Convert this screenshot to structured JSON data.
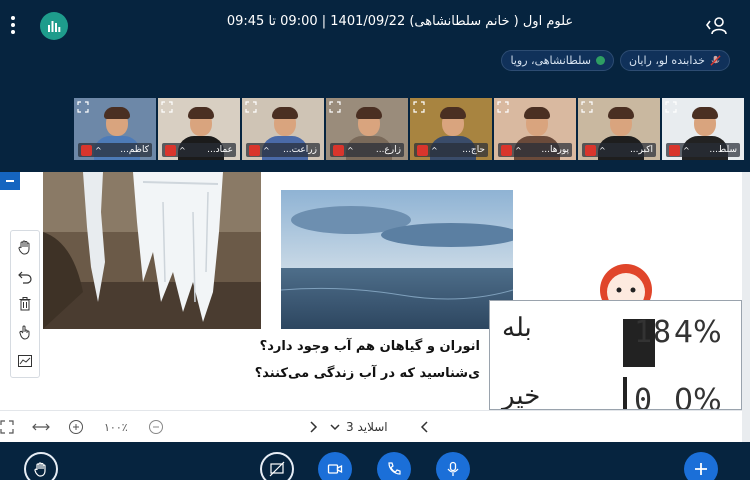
{
  "header": {
    "title": "علوم اول ( خانم سلطانشاهی) 1401/09/22 | 09:00 تا 09:45"
  },
  "presenters": [
    {
      "name": "سلطانشاهی، رویا",
      "status": "talking"
    },
    {
      "name": "خدابنده لو، رایان",
      "status": "muted"
    }
  ],
  "webcams": [
    {
      "label": "کاظم...",
      "bg": "#6d88a8",
      "body": "#4d7bb8"
    },
    {
      "label": "عماد...",
      "bg": "#d8cfc2",
      "body": "#1b1b1b"
    },
    {
      "label": "زراعت...",
      "bg": "#cfc4b5",
      "body": "#4a6aa8"
    },
    {
      "label": "زارع...",
      "bg": "#9a8c7b",
      "body": "#7a6a5a"
    },
    {
      "label": "حاج...",
      "bg": "#a88440",
      "body": "#3a4c6a"
    },
    {
      "label": "پورها...",
      "bg": "#d9b9a0",
      "body": "#6a4a3a"
    },
    {
      "label": "اکبر...",
      "bg": "#c9b8a0",
      "body": "#1e1e1e"
    },
    {
      "label": "سلط...",
      "bg": "#e8ecef",
      "body": "#222222"
    }
  ],
  "whiteboard": {
    "question_line1": "انوران و گیاهان هم آب وجود دارد؟",
    "question_line2": "ی‌شناسید که در آب زندگی می‌کنند؟"
  },
  "poll": {
    "rows": [
      {
        "answer": "بله",
        "count": "18",
        "percent": "4%"
      },
      {
        "answer": "خیر",
        "count": "0",
        "percent": "0%"
      }
    ]
  },
  "slide_controls": {
    "zoom": "۱۰۰٪",
    "slide_label": "اسلاید 3"
  },
  "colors": {
    "background": "#06243f",
    "accent": "#1b6fd8",
    "stats": "#1e9c8c"
  }
}
